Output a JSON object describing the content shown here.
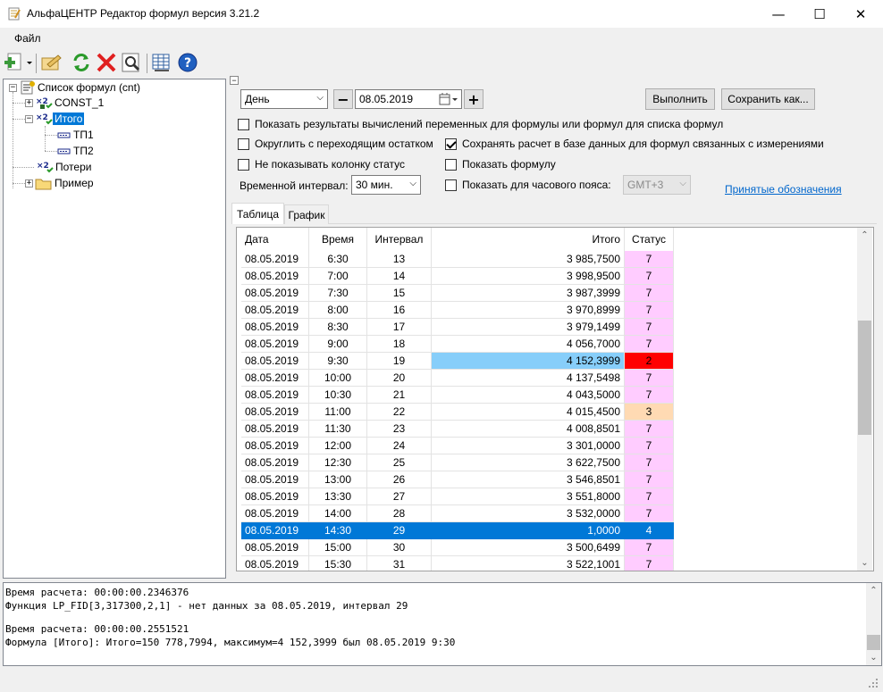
{
  "window": {
    "title": "АльфаЦЕНТР Редактор формул версия 3.21.2",
    "minimize": "—",
    "maximize": "☐",
    "close": "✕"
  },
  "menu": {
    "file": "Файл"
  },
  "toolbar_icons": [
    "new-icon",
    "edit-icon",
    "refresh-icon",
    "delete-icon",
    "preview-icon",
    "table-icon",
    "help-icon"
  ],
  "tree": {
    "root": "Список формул (cnt)",
    "items": [
      "CONST_1",
      "Итого",
      "ТП1",
      "ТП2",
      "Потери",
      "Пример"
    ]
  },
  "controls": {
    "period": "День",
    "date": "08.05.2019",
    "minus": "−",
    "plus": "+",
    "execute": "Выполнить",
    "save_as": "Сохранить как...",
    "cb_show_results": "Показать результаты вычислений переменных для формулы или формул для списка формул",
    "cb_round": "Округлить с переходящим остатком",
    "cb_save_db": "Сохранять расчет в базе данных для формул связанных с измерениями",
    "cb_hide_status": "Не показывать колонку статус",
    "cb_show_formula": "Показать формулу",
    "interval_label": "Временной интервал:",
    "interval_value": "30 мин.",
    "cb_timezone": "Показать для часового пояса:",
    "timezone_value": "GMT+3",
    "legend_link": "Принятые обозначения",
    "save_db_checked": true
  },
  "tabs": [
    "Таблица",
    "График"
  ],
  "grid": {
    "headers": [
      "Дата",
      "Время",
      "Интервал",
      "Итого",
      "Статус"
    ],
    "rows": [
      [
        "08.05.2019",
        "6:30",
        "13",
        "3 985,7500",
        "7"
      ],
      [
        "08.05.2019",
        "7:00",
        "14",
        "3 998,9500",
        "7"
      ],
      [
        "08.05.2019",
        "7:30",
        "15",
        "3 987,3999",
        "7"
      ],
      [
        "08.05.2019",
        "8:00",
        "16",
        "3 970,8999",
        "7"
      ],
      [
        "08.05.2019",
        "8:30",
        "17",
        "3 979,1499",
        "7"
      ],
      [
        "08.05.2019",
        "9:00",
        "18",
        "4 056,7000",
        "7"
      ],
      [
        "08.05.2019",
        "9:30",
        "19",
        "4 152,3999",
        "2"
      ],
      [
        "08.05.2019",
        "10:00",
        "20",
        "4 137,5498",
        "7"
      ],
      [
        "08.05.2019",
        "10:30",
        "21",
        "4 043,5000",
        "7"
      ],
      [
        "08.05.2019",
        "11:00",
        "22",
        "4 015,4500",
        "3"
      ],
      [
        "08.05.2019",
        "11:30",
        "23",
        "4 008,8501",
        "7"
      ],
      [
        "08.05.2019",
        "12:00",
        "24",
        "3 301,0000",
        "7"
      ],
      [
        "08.05.2019",
        "12:30",
        "25",
        "3 622,7500",
        "7"
      ],
      [
        "08.05.2019",
        "13:00",
        "26",
        "3 546,8501",
        "7"
      ],
      [
        "08.05.2019",
        "13:30",
        "27",
        "3 551,8000",
        "7"
      ],
      [
        "08.05.2019",
        "14:00",
        "28",
        "3 532,0000",
        "7"
      ],
      [
        "08.05.2019",
        "14:30",
        "29",
        "1,0000",
        "4"
      ],
      [
        "08.05.2019",
        "15:00",
        "30",
        "3 500,6499",
        "7"
      ],
      [
        "08.05.2019",
        "15:30",
        "31",
        "3 522,1001",
        "7"
      ]
    ],
    "selected_row": 16,
    "max_row": 6,
    "warn_row": 9,
    "colors": {
      "status_default": "#ffccff",
      "status_max": "#ff0000",
      "status_warn": "#ffdab3",
      "max_value_bg": "#87cefa",
      "selection": "#0078d7"
    }
  },
  "log": [
    "Время расчета: 00:00:00.2346376",
    "Функция LP_FID[3,317300,2,1] - нет данных за 08.05.2019, интервал 29",
    "",
    "Время расчета: 00:00:00.2551521",
    "Формула [Итого]: Итого=150 778,7994, максимум=4 152,3999 был 08.05.2019 9:30"
  ]
}
